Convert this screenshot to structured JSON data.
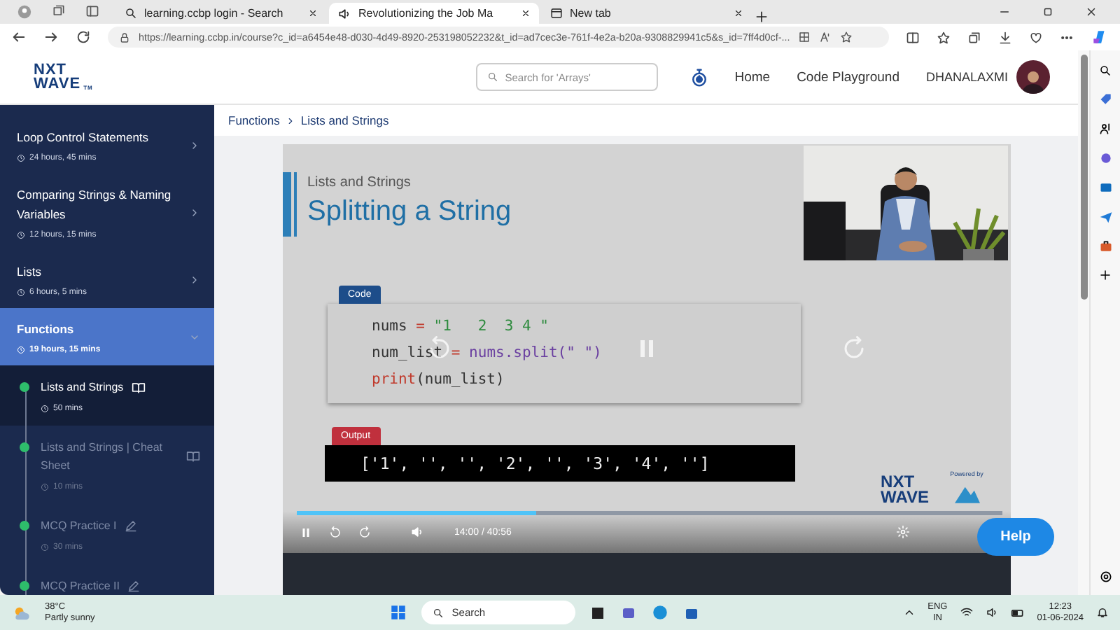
{
  "browser": {
    "tabs": [
      {
        "label": "learning.ccbp login - Search",
        "selected": false,
        "kind": "search"
      },
      {
        "label": "Revolutionizing the Job Ma",
        "selected": true,
        "kind": "page"
      },
      {
        "label": "New tab",
        "selected": false,
        "kind": "newtab"
      }
    ],
    "url": "https://learning.ccbp.in/course?c_id=a6454e48-d030-4d49-8920-253198052232&t_id=ad7cec3e-761f-4e2a-b20a-9308829941c5&s_id=7ff4d0cf-..."
  },
  "header": {
    "logo_top": "NXT",
    "logo_bottom": "WAVE",
    "logo_mark": "TM",
    "search": {
      "placeholder": "Search for 'Arrays'"
    },
    "nav": [
      "Home",
      "Code Playground"
    ],
    "user": "DHANALAXMI"
  },
  "sidebar": {
    "modules": [
      {
        "title": "Loop Control Statements",
        "duration": "24 hours, 45 mins",
        "expanded": false
      },
      {
        "title": "Comparing Strings & Naming Variables",
        "duration": "12 hours, 15 mins",
        "expanded": false
      },
      {
        "title": "Lists",
        "duration": "6 hours, 5 mins",
        "expanded": false
      },
      {
        "title": "Functions",
        "duration": "19 hours, 15 mins",
        "expanded": true,
        "children": [
          {
            "title": "Lists and Strings",
            "duration": "50 mins",
            "kind": "reading",
            "completed": true,
            "selected": true
          },
          {
            "title": "Lists and Strings | Cheat Sheet",
            "duration": "10 mins",
            "kind": "reading",
            "completed": true,
            "selected": false
          },
          {
            "title": "MCQ Practice I",
            "duration": "30 mins",
            "kind": "practice",
            "completed": true,
            "selected": false
          },
          {
            "title": "MCQ Practice II",
            "kind": "practice",
            "completed": true,
            "selected": false
          }
        ]
      }
    ]
  },
  "breadcrumb": [
    "Functions",
    "Lists and Strings"
  ],
  "video": {
    "slide": {
      "subtitle": "Lists and Strings",
      "title": "Splitting a String",
      "code_tag": "Code",
      "code": [
        [
          {
            "text": "nums",
            "kind": "plain"
          },
          {
            "text": " = ",
            "kind": "op"
          },
          {
            "text": "\"1   2  3 4 \"",
            "kind": "string"
          }
        ],
        [
          {
            "text": "num_list",
            "kind": "plain"
          },
          {
            "text": " = ",
            "kind": "op"
          },
          {
            "text": "nums.split(\" \")",
            "kind": "call"
          }
        ],
        [
          {
            "text": "print",
            "kind": "builtin"
          },
          {
            "text": "(num_list)",
            "kind": "plain"
          }
        ]
      ],
      "output_tag": "Output",
      "output": "['1', '', '', '2', '', '3', '4', '']",
      "brand_top": "NXT",
      "brand_bottom": "WAVE",
      "powered_by": "Powered by"
    },
    "progress": {
      "level": 0.34
    },
    "playing": true,
    "time": "14:00 / 40:56"
  },
  "help": "Help",
  "taskbar": {
    "temperature": "38°C",
    "weather": "Partly sunny",
    "search": "Search",
    "lang": "ENG",
    "region": "IN",
    "time": "12:23",
    "date": "01-06-2024"
  }
}
